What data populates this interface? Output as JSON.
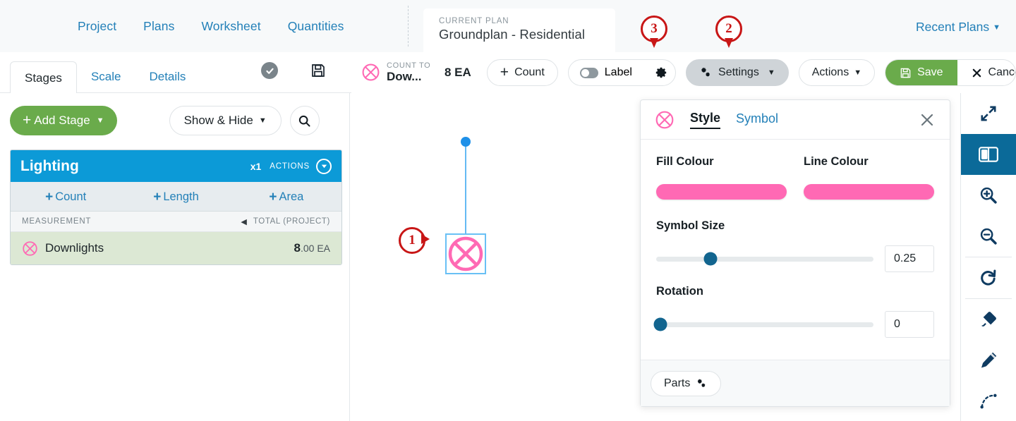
{
  "topnav": {
    "links": [
      {
        "label": "Project",
        "name": "nav-project"
      },
      {
        "label": "Plans",
        "name": "nav-plans"
      },
      {
        "label": "Worksheet",
        "name": "nav-worksheet"
      },
      {
        "label": "Quantities",
        "name": "nav-quantities"
      }
    ],
    "plan_card": {
      "kicker": "CURRENT PLAN",
      "title": "Groundplan - Residential"
    },
    "recent_plans": "Recent Plans"
  },
  "annotations": [
    {
      "number": "1"
    },
    {
      "number": "2"
    },
    {
      "number": "3"
    }
  ],
  "tabs": {
    "items": [
      {
        "label": "Stages",
        "active": true
      },
      {
        "label": "Scale",
        "active": false
      },
      {
        "label": "Details",
        "active": false
      }
    ],
    "check_icon": "check-icon",
    "save_disk_icon": "floppy-disk-icon"
  },
  "toolbar": {
    "measurement_kicker": "COUNT TO",
    "measurement_name": "Dow...",
    "quantity": "8 EA",
    "count_label": "Count",
    "label_toggle": "Label",
    "gear_icon": "gear-icon",
    "settings_label": "Settings",
    "actions_label": "Actions",
    "save_label": "Save",
    "cancel_label": "Cancel",
    "symbol_icon": "crossed-circle-icon"
  },
  "left_panel": {
    "add_stage_label": "Add Stage",
    "show_hide_label": "Show & Hide",
    "search_icon": "search-icon",
    "stage": {
      "title": "Lighting",
      "multiplier": "x1",
      "actions_label": "ACTIONS",
      "add_buttons": [
        {
          "label": "Count"
        },
        {
          "label": "Length"
        },
        {
          "label": "Area"
        }
      ],
      "table_headers": {
        "left": "MEASUREMENT",
        "right": "TOTAL (PROJECT)"
      },
      "rows": [
        {
          "name": "Downlights",
          "value_whole": "8",
          "value_frac": ".00 EA",
          "icon": "crossed-circle-icon"
        }
      ]
    }
  },
  "style_panel": {
    "symbol_icon": "crossed-circle-icon",
    "tabs": [
      {
        "label": "Style",
        "active": true
      },
      {
        "label": "Symbol",
        "active": false
      }
    ],
    "close_icon": "close-icon",
    "fill_colour_label": "Fill Colour",
    "fill_colour_value": "#ff69b4",
    "line_colour_label": "Line Colour",
    "line_colour_value": "#ff69b4",
    "symbol_size_label": "Symbol Size",
    "symbol_size_value": "0.25",
    "symbol_size_percent": 25,
    "rotation_label": "Rotation",
    "rotation_value": "0",
    "rotation_percent": 0,
    "parts_label": "Parts"
  },
  "right_tools": [
    {
      "name": "fullscreen-icon",
      "active": false
    },
    {
      "name": "split-panel-icon",
      "active": true
    },
    {
      "name": "zoom-in-icon",
      "active": false
    },
    {
      "name": "zoom-out-icon",
      "active": false
    },
    {
      "name": "redo-icon",
      "active": false
    },
    {
      "name": "eraser-icon",
      "active": false
    },
    {
      "name": "pencil-icon",
      "active": false
    },
    {
      "name": "curve-icon",
      "active": false
    }
  ],
  "canvas": {
    "marker_icon": "crossed-circle-symbol",
    "handle_icon": "drag-handle-dot"
  },
  "colors": {
    "accent_blue": "#0c9ad7",
    "link_blue": "#2380b8",
    "green": "#6aab4b",
    "pink": "#ff69b4",
    "annotation_red": "#c81616",
    "slider_blue": "#12658f"
  }
}
